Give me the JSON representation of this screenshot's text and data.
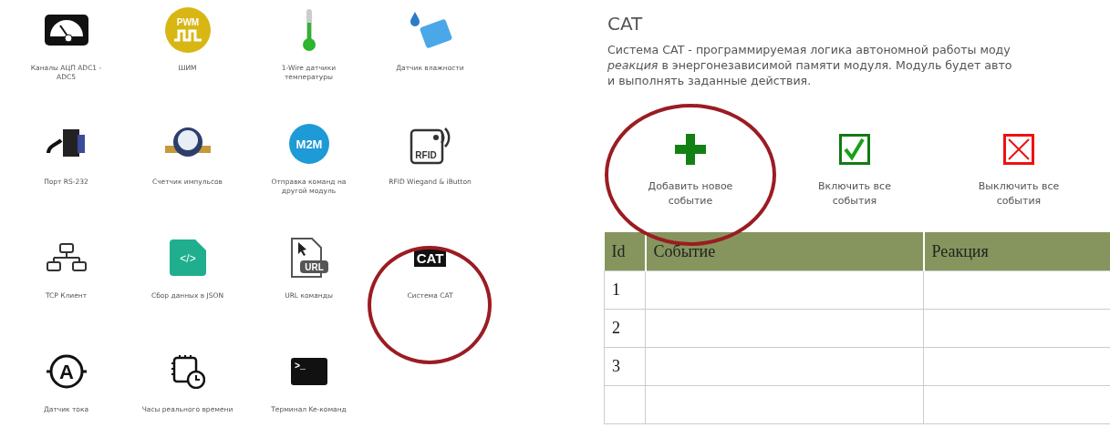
{
  "modules": [
    {
      "label": "Каналы АЦП ADC1 - ADC5",
      "kind": "gauge",
      "circled": false
    },
    {
      "label": "ШИМ",
      "kind": "pwm",
      "icon_text": "PWM",
      "circled": false
    },
    {
      "label": "1-Wire датчики температуры",
      "kind": "thermometer",
      "circled": false
    },
    {
      "label": "Датчик влажности",
      "kind": "humidity",
      "circled": false
    },
    {
      "label": "Порт RS-232",
      "kind": "serial",
      "circled": false
    },
    {
      "label": "Счетчик импульсов",
      "kind": "meter",
      "circled": false
    },
    {
      "label": "Отправка команд на другой модуль",
      "kind": "m2m",
      "icon_text": "M2M",
      "circled": false
    },
    {
      "label": "RFID Wiegand & iButton",
      "kind": "rfid",
      "icon_text": "RFID",
      "circled": false
    },
    {
      "label": "TCP Клиент",
      "kind": "network",
      "circled": false
    },
    {
      "label": "Сбор данных в JSON",
      "kind": "json",
      "icon_text": "</>",
      "circled": false
    },
    {
      "label": "URL команды",
      "kind": "url",
      "icon_text": "URL",
      "circled": false
    },
    {
      "label": "Система CAT",
      "kind": "cat",
      "icon_text": "CAT",
      "circled": true
    },
    {
      "label": "Датчик тока",
      "kind": "ammeter",
      "icon_text": "A",
      "circled": false
    },
    {
      "label": "Часы реального времени",
      "kind": "clock",
      "circled": false
    },
    {
      "label": "Терминал Ke-команд",
      "kind": "terminal",
      "icon_text": ">_",
      "circled": false
    }
  ],
  "cat": {
    "title": "CAT",
    "description": [
      "Система CAT - программируемая логика автономной работы моду",
      "*реакция* в энергонезависимой памяти модуля. Модуль будет авто",
      "и выполнять заданные действия."
    ],
    "actions": [
      {
        "label": "Добавить новое событие",
        "kind": "add",
        "circled": true
      },
      {
        "label": "Включить все события",
        "kind": "enable",
        "circled": false
      },
      {
        "label": "Выключить все события",
        "kind": "disable",
        "circled": false
      }
    ],
    "table": {
      "columns": [
        "Id",
        "Событие",
        "Реакция"
      ],
      "rows": [
        [
          "1",
          "",
          ""
        ],
        [
          "2",
          "",
          ""
        ],
        [
          "3",
          "",
          ""
        ]
      ]
    }
  }
}
